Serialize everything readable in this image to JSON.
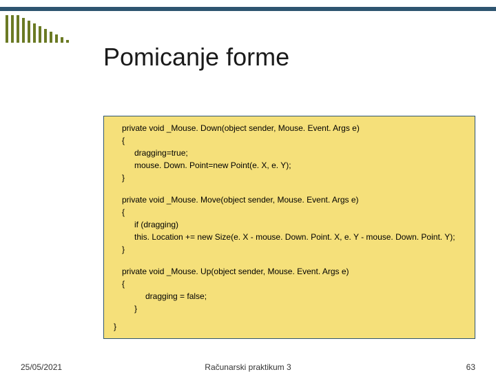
{
  "title": "Pomicanje forme",
  "bars": [
    40,
    40,
    40,
    36,
    32,
    28,
    24,
    20,
    16,
    12,
    8,
    4
  ],
  "code": {
    "block1": {
      "sig": "private void _Mouse. Down(object sender, Mouse. Event. Args e)",
      "open": "{",
      "l1": "dragging=true;",
      "l2": "mouse. Down. Point=new Point(e. X, e. Y);",
      "close": "}"
    },
    "block2": {
      "sig": "private void _Mouse. Move(object sender, Mouse. Event. Args e)",
      "open": "{",
      "l1": "if (dragging)",
      "l2": "this. Location += new Size(e. X - mouse. Down. Point. X, e. Y - mouse. Down. Point. Y);",
      "close": "}"
    },
    "block3": {
      "sig": "private void _Mouse. Up(object sender, Mouse. Event. Args e)",
      "open": "{",
      "l1": "dragging = false;",
      "close": "}"
    },
    "finalclose": "}"
  },
  "footer": {
    "date": "25/05/2021",
    "course": "Računarski praktikum 3",
    "page": "63"
  }
}
